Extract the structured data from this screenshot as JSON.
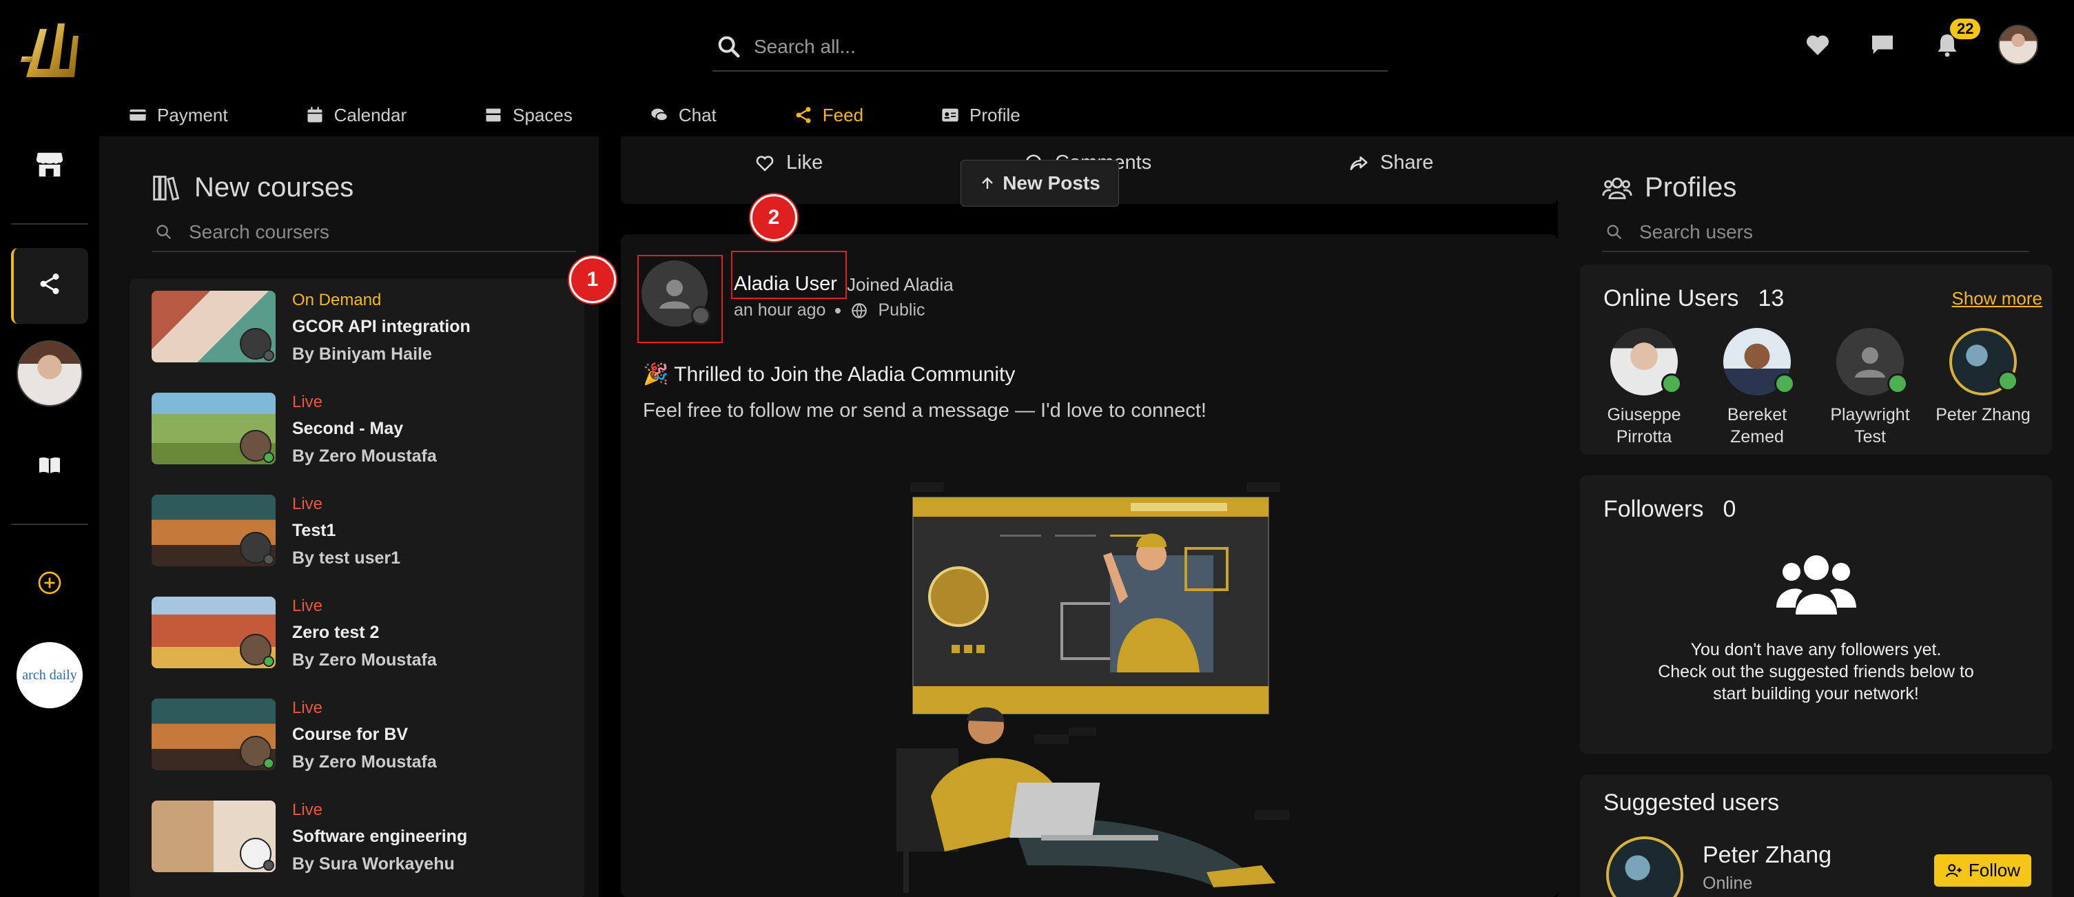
{
  "header": {
    "search_placeholder": "Search all...",
    "notification_count": "22"
  },
  "tabs": [
    {
      "label": "Payment",
      "icon": "credit-card-icon"
    },
    {
      "label": "Calendar",
      "icon": "calendar-icon"
    },
    {
      "label": "Spaces",
      "icon": "spaces-icon"
    },
    {
      "label": "Chat",
      "icon": "chat-icon"
    },
    {
      "label": "Feed",
      "icon": "share-icon",
      "active": true
    },
    {
      "label": "Profile",
      "icon": "id-card-icon"
    }
  ],
  "rail": {
    "brand_logo_text": "arch daily"
  },
  "courses_panel": {
    "title": "New courses",
    "search_placeholder": "Search coursers",
    "by_label": "By",
    "items": [
      {
        "status": "On Demand",
        "name": "GCOR API integration",
        "author": "Biniyam Haile"
      },
      {
        "status": "Live",
        "name": "Second - May",
        "author": "Zero Moustafa"
      },
      {
        "status": "Live",
        "name": "Test1",
        "author": "test user1"
      },
      {
        "status": "Live",
        "name": "Zero test 2",
        "author": "Zero Moustafa"
      },
      {
        "status": "Live",
        "name": "Course for BV",
        "author": "Zero Moustafa"
      },
      {
        "status": "Live",
        "name": "Software engineering",
        "author": "Sura Workayehu"
      }
    ]
  },
  "post_actions": {
    "like": "Like",
    "comments": "Comments",
    "share": "Share",
    "new_posts": "New Posts"
  },
  "post": {
    "author": "Aladia User",
    "activity": "Joined Aladia",
    "time": "an hour ago",
    "visibility": "Public",
    "headline": "🎉 Thrilled to Join the Aladia Community",
    "body": "Feel free to follow me or send a message — I'd love to connect!"
  },
  "annotations": {
    "marker_1": "1",
    "marker_2": "2"
  },
  "profiles_panel": {
    "title": "Profiles",
    "search_placeholder": "Search users",
    "online": {
      "title": "Online Users",
      "count": "13",
      "show_more": "Show more",
      "users": [
        {
          "name": "Giuseppe Pirrotta"
        },
        {
          "name": "Bereket Zemed"
        },
        {
          "name": "Playwright Test"
        },
        {
          "name": "Peter Zhang"
        }
      ]
    },
    "followers": {
      "title": "Followers",
      "count": "0",
      "empty_line1": "You don't have any followers yet.",
      "empty_line2": "Check out the suggested friends below to",
      "empty_line3": "start building your network!"
    },
    "suggested": {
      "title": "Suggested users",
      "name": "Peter Zhang",
      "status": "Online",
      "follow_label": "Follow"
    }
  },
  "colors": {
    "accent": "#f5b81c",
    "live": "#e8593b",
    "online": "#4caf50",
    "annotation": "#e01f1f"
  }
}
